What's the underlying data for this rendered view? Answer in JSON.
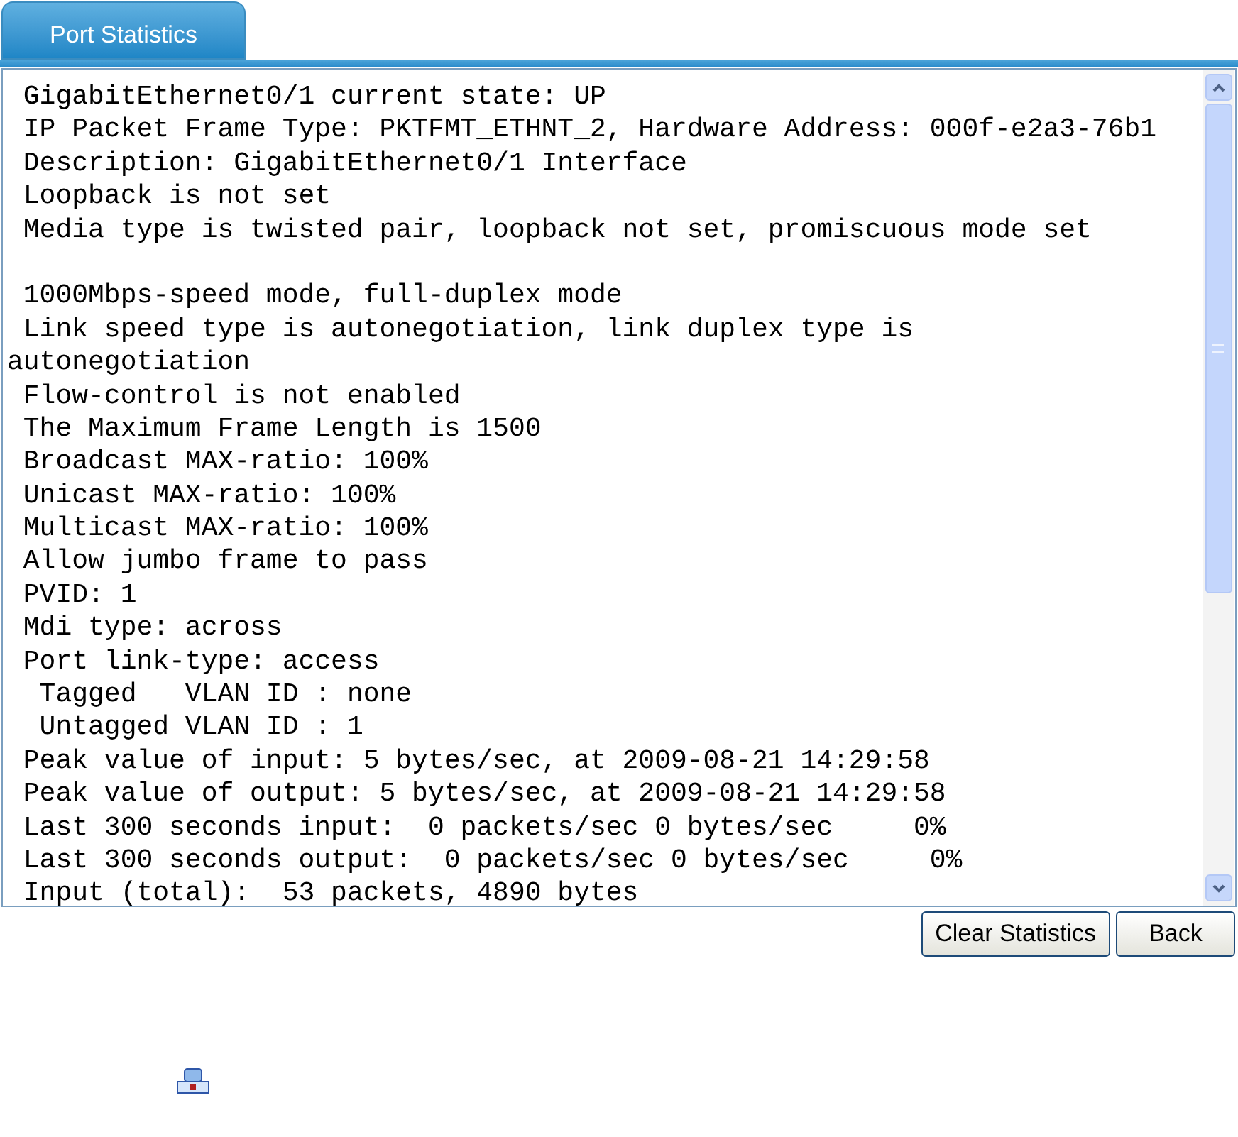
{
  "tabs": [
    {
      "label": "Port Statistics",
      "selected": true
    }
  ],
  "output_blocks": [
    [
      " GigabitEthernet0/1 current state: UP",
      " IP Packet Frame Type: PKTFMT_ETHNT_2, Hardware Address: 000f-e2a3-76b1",
      " Description: GigabitEthernet0/1 Interface",
      " Loopback is not set",
      " Media type is twisted pair, loopback not set, promiscuous mode set"
    ],
    [
      " 1000Mbps-speed mode, full-duplex mode",
      " Link speed type is autonegotiation, link duplex type is",
      "autonegotiation",
      " Flow-control is not enabled",
      " The Maximum Frame Length is 1500",
      " Broadcast MAX-ratio: 100%",
      " Unicast MAX-ratio: 100%",
      " Multicast MAX-ratio: 100%",
      " Allow jumbo frame to pass",
      " PVID: 1",
      " Mdi type: across",
      " Port link-type: access",
      "  Tagged   VLAN ID : none",
      "  Untagged VLAN ID : 1",
      " Peak value of input: 5 bytes/sec, at 2009-08-21 14:29:58",
      " Peak value of output: 5 bytes/sec, at 2009-08-21 14:29:58",
      " Last 300 seconds input:  0 packets/sec 0 bytes/sec     0%",
      " Last 300 seconds output:  0 packets/sec 0 bytes/sec     0%",
      " Input (total):  53 packets, 4890 bytes"
    ]
  ],
  "buttons": [
    "Clear Statistics",
    "Back"
  ]
}
